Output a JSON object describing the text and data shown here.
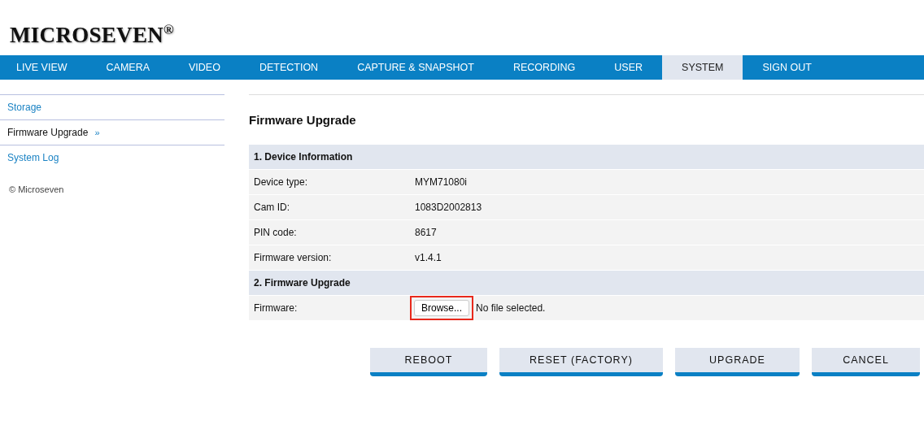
{
  "logo": {
    "text": "MICROSEVEN",
    "mark": "®"
  },
  "nav": [
    {
      "label": "LIVE VIEW",
      "selected": false
    },
    {
      "label": "CAMERA",
      "selected": false
    },
    {
      "label": "VIDEO",
      "selected": false
    },
    {
      "label": "DETECTION",
      "selected": false
    },
    {
      "label": "CAPTURE & SNAPSHOT",
      "selected": false
    },
    {
      "label": "RECORDING",
      "selected": false
    },
    {
      "label": "USER",
      "selected": false
    },
    {
      "label": "SYSTEM",
      "selected": true
    },
    {
      "label": "SIGN OUT",
      "selected": false
    }
  ],
  "sidebar": {
    "items": [
      {
        "label": "Storage",
        "selected": false
      },
      {
        "label": "Firmware Upgrade",
        "selected": true,
        "marker": "»"
      },
      {
        "label": "System Log",
        "selected": false
      }
    ],
    "copyright": "© Microseven"
  },
  "page_title": "Firmware Upgrade",
  "sections": [
    {
      "heading": "1. Device Information",
      "rows": [
        {
          "label": "Device type:",
          "value": "MYM71080i"
        },
        {
          "label": "Cam ID:",
          "value": "1083D2002813"
        },
        {
          "label": "PIN code:",
          "value": "8617"
        },
        {
          "label": "Firmware version:",
          "value": "v1.4.1"
        }
      ]
    },
    {
      "heading": "2. Firmware Upgrade",
      "rows": [
        {
          "label": "Firmware:",
          "kind": "file",
          "button": "Browse...",
          "status": "No file selected.",
          "highlighted": true
        }
      ]
    }
  ],
  "buttons": [
    "REBOOT",
    "RESET (FACTORY)",
    "UPGRADE",
    "CANCEL"
  ]
}
